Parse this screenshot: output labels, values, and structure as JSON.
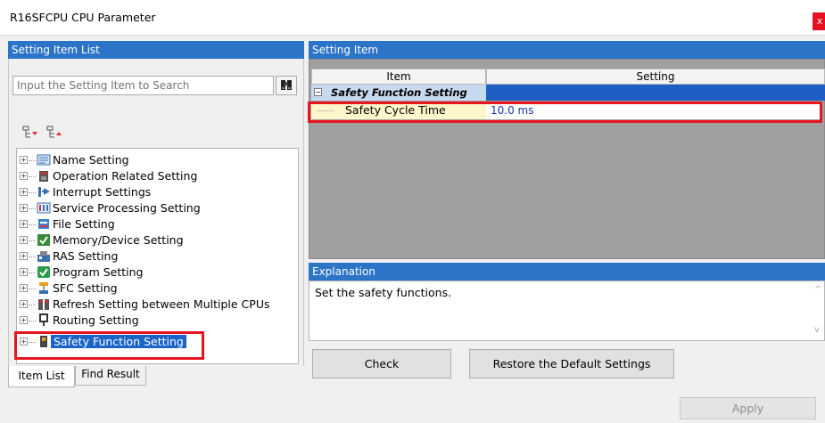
{
  "window": {
    "title": "R16SFCPU CPU Parameter",
    "close_glyph": "x"
  },
  "left_panel": {
    "header": "Setting Item List",
    "search_placeholder": "Input the Setting Item to Search",
    "tree_items": [
      {
        "label": "Name Setting",
        "icon": "name-setting-icon"
      },
      {
        "label": "Operation Related Setting",
        "icon": "operation-setting-icon"
      },
      {
        "label": "Interrupt Settings",
        "icon": "interrupt-icon"
      },
      {
        "label": "Service Processing Setting",
        "icon": "service-processing-icon"
      },
      {
        "label": "File Setting",
        "icon": "file-setting-icon"
      },
      {
        "label": "Memory/Device Setting",
        "icon": "memory-device-icon"
      },
      {
        "label": "RAS Setting",
        "icon": "ras-icon"
      },
      {
        "label": "Program Setting",
        "icon": "program-icon"
      },
      {
        "label": "SFC Setting",
        "icon": "sfc-icon"
      },
      {
        "label": "Refresh Setting between Multiple CPUs",
        "icon": "refresh-icon"
      },
      {
        "label": "Routing Setting",
        "icon": "routing-icon"
      },
      {
        "label": "Safety Function Setting",
        "icon": "safety-function-icon",
        "selected": true
      }
    ],
    "tabs": {
      "item_list": "Item List",
      "find_result": "Find Result"
    }
  },
  "right_panel": {
    "header": "Setting Item",
    "columns": {
      "item": "Item",
      "setting": "Setting"
    },
    "group": "Safety Function Setting",
    "row": {
      "item": "Safety Cycle Time",
      "setting": "10.0 ms"
    },
    "explanation_header": "Explanation",
    "explanation_text": "Set the safety functions."
  },
  "buttons": {
    "check": "Check",
    "restore": "Restore the Default Settings",
    "apply": "Apply"
  },
  "colors": {
    "header_blue": "#2b74c7",
    "highlight_red": "#e8141e",
    "selection_blue": "#1a63c7",
    "value_blue": "#1633b0"
  }
}
